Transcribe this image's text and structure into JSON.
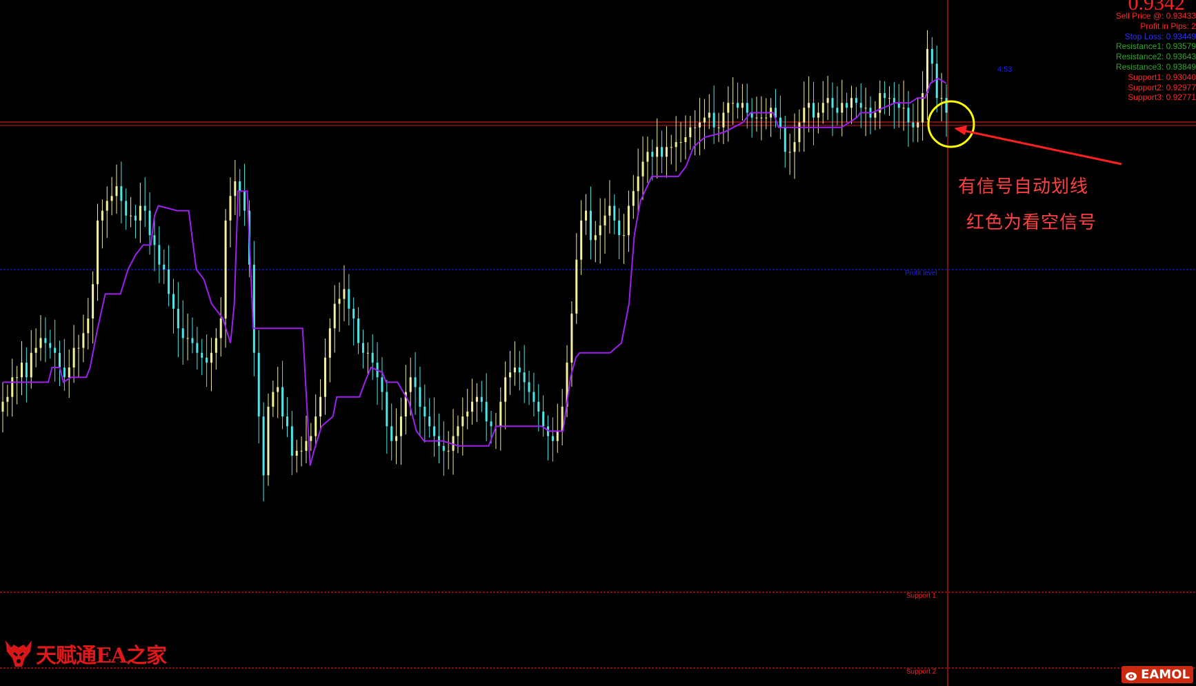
{
  "info_panel": {
    "current_price": "0.9342",
    "lines": [
      {
        "text": "Sell Price @: 0.93433",
        "color": "#ff2a2a"
      },
      {
        "text": "Profit in Pips: 2",
        "color": "#ff2a2a"
      },
      {
        "text": "Stop Loss: 0.93449",
        "color": "#3030ff"
      },
      {
        "text": "Resistance1: 0.93579",
        "color": "#2fa82f"
      },
      {
        "text": "Resistance2: 0.93643",
        "color": "#2fa82f"
      },
      {
        "text": "Resistance3: 0.93849",
        "color": "#2fa82f"
      },
      {
        "text": "Support1: 0.93040",
        "color": "#ff2a2a"
      },
      {
        "text": "Support2: 0.92977",
        "color": "#ff2a2a"
      },
      {
        "text": "Support3: 0.92771",
        "color": "#ff2a2a"
      }
    ]
  },
  "bar_timer": "4:53",
  "levels": {
    "profit_level": "Profit level",
    "support1": "Support 1",
    "support2": "Support 2"
  },
  "annotation": {
    "line1": "有信号自动划线",
    "line2": "红色为看空信号"
  },
  "watermark": {
    "brand": "天赋通EA之家",
    "site": "EAMOL"
  },
  "colors": {
    "background": "#000000",
    "bull_candle": "#f5f0a0",
    "bear_candle": "#4fe8e8",
    "signal_line": "#a020f0",
    "price_line": "#ff2020",
    "profit_level": "#2020ff",
    "support_level": "#ff2020",
    "highlight_circle": "#ffff00"
  },
  "chart_data": {
    "type": "candlestick",
    "title": "",
    "ylim": [
      0.925,
      0.939
    ],
    "grid": false,
    "horizontal_levels": [
      {
        "name": "Support 1",
        "value": 0.9304
      },
      {
        "name": "Support 2",
        "value": 0.92977
      }
    ],
    "closes": [
      0.9308,
      0.9309,
      0.9313,
      0.9313,
      0.9316,
      0.9313,
      0.9318,
      0.9319,
      0.9321,
      0.932,
      0.9319,
      0.9318,
      0.9315,
      0.9313,
      0.9315,
      0.9319,
      0.9319,
      0.9322,
      0.9325,
      0.9332,
      0.9345,
      0.9347,
      0.9349,
      0.935,
      0.9352,
      0.9349,
      0.9346,
      0.9346,
      0.9345,
      0.9348,
      0.9347,
      0.9342,
      0.934,
      0.9336,
      0.9335,
      0.933,
      0.9327,
      0.9323,
      0.9321,
      0.9321,
      0.932,
      0.9318,
      0.9317,
      0.9316,
      0.9318,
      0.9321,
      0.9325,
      0.9345,
      0.935,
      0.9353,
      0.9351,
      0.9347,
      0.9336,
      0.9318,
      0.9305,
      0.9293,
      0.9307,
      0.931,
      0.9311,
      0.9305,
      0.9303,
      0.9297,
      0.9298,
      0.9298,
      0.93,
      0.9301,
      0.9305,
      0.9309,
      0.9317,
      0.9323,
      0.9328,
      0.9329,
      0.9331,
      0.9327,
      0.9325,
      0.932,
      0.9318,
      0.9318,
      0.9316,
      0.9313,
      0.931,
      0.9303,
      0.93,
      0.9301,
      0.9305,
      0.931,
      0.9313,
      0.9311,
      0.9307,
      0.9305,
      0.9303,
      0.9301,
      0.9299,
      0.9298,
      0.9298,
      0.9301,
      0.9303,
      0.9305,
      0.9306,
      0.9308,
      0.9309,
      0.9308,
      0.9304,
      0.9303,
      0.9303,
      0.9308,
      0.9313,
      0.9314,
      0.9315,
      0.9314,
      0.9312,
      0.931,
      0.9308,
      0.9306,
      0.9303,
      0.9301,
      0.93,
      0.9302,
      0.9307,
      0.9316,
      0.9326,
      0.9337,
      0.9345,
      0.9347,
      0.9341,
      0.9342,
      0.9344,
      0.9346,
      0.9348,
      0.9345,
      0.9342,
      0.9342,
      0.9348,
      0.9351,
      0.9354,
      0.9357,
      0.9359,
      0.9358,
      0.936,
      0.9358,
      0.936,
      0.936,
      0.9361,
      0.9361,
      0.9362,
      0.9364,
      0.9364,
      0.9365,
      0.9366,
      0.9367,
      0.9364,
      0.9364,
      0.9367,
      0.9369,
      0.9369,
      0.9368,
      0.9369,
      0.9367,
      0.9366,
      0.9366,
      0.9366,
      0.9366,
      0.9368,
      0.9366,
      0.9364,
      0.9359,
      0.9359,
      0.9361,
      0.9365,
      0.9368,
      0.9369,
      0.9366,
      0.9367,
      0.9369,
      0.937,
      0.9368,
      0.9367,
      0.9369,
      0.9368,
      0.937,
      0.9369,
      0.9368,
      0.9368,
      0.9366,
      0.9367,
      0.9371,
      0.937,
      0.937,
      0.9369,
      0.9368,
      0.9368,
      0.9365,
      0.9364,
      0.9365,
      0.9371,
      0.938,
      0.9377,
      0.937,
      0.937,
      0.9367
    ],
    "signal_line": [
      [
        0,
        0.9312
      ],
      [
        60,
        0.9312
      ],
      [
        65,
        0.9315
      ],
      [
        75,
        0.9315
      ],
      [
        80,
        0.9312
      ],
      [
        90,
        0.9313
      ],
      [
        110,
        0.9313
      ],
      [
        115,
        0.9315
      ],
      [
        125,
        0.9323
      ],
      [
        135,
        0.933
      ],
      [
        155,
        0.933
      ],
      [
        165,
        0.9335
      ],
      [
        175,
        0.9338
      ],
      [
        185,
        0.934
      ],
      [
        195,
        0.934
      ],
      [
        200,
        0.9346
      ],
      [
        205,
        0.9348
      ],
      [
        230,
        0.9347
      ],
      [
        245,
        0.9347
      ],
      [
        255,
        0.9335
      ],
      [
        265,
        0.9333
      ],
      [
        275,
        0.9328
      ],
      [
        290,
        0.9325
      ],
      [
        300,
        0.932
      ],
      [
        305,
        0.9328
      ],
      [
        310,
        0.9351
      ],
      [
        322,
        0.9351
      ],
      [
        330,
        0.9323
      ],
      [
        395,
        0.9323
      ],
      [
        405,
        0.9295
      ],
      [
        410,
        0.9298
      ],
      [
        420,
        0.9303
      ],
      [
        435,
        0.9305
      ],
      [
        440,
        0.9309
      ],
      [
        470,
        0.9309
      ],
      [
        477,
        0.9312
      ],
      [
        485,
        0.9315
      ],
      [
        500,
        0.9314
      ],
      [
        505,
        0.9312
      ],
      [
        520,
        0.9312
      ],
      [
        535,
        0.9308
      ],
      [
        545,
        0.9302
      ],
      [
        555,
        0.93
      ],
      [
        565,
        0.93
      ],
      [
        580,
        0.93
      ],
      [
        600,
        0.9299
      ],
      [
        640,
        0.9299
      ],
      [
        650,
        0.9303
      ],
      [
        710,
        0.9303
      ],
      [
        720,
        0.9302
      ],
      [
        738,
        0.9302
      ],
      [
        748,
        0.9313
      ],
      [
        755,
        0.9317
      ],
      [
        760,
        0.9318
      ],
      [
        800,
        0.9318
      ],
      [
        815,
        0.932
      ],
      [
        825,
        0.9328
      ],
      [
        832,
        0.9342
      ],
      [
        840,
        0.9349
      ],
      [
        855,
        0.9354
      ],
      [
        890,
        0.9354
      ],
      [
        900,
        0.9356
      ],
      [
        910,
        0.936
      ],
      [
        925,
        0.9362
      ],
      [
        950,
        0.9363
      ],
      [
        975,
        0.9365
      ],
      [
        985,
        0.9367
      ],
      [
        1015,
        0.9367
      ],
      [
        1022,
        0.9364
      ],
      [
        1105,
        0.9364
      ],
      [
        1115,
        0.9365
      ],
      [
        1125,
        0.9366
      ],
      [
        1130,
        0.9367
      ],
      [
        1145,
        0.9367
      ],
      [
        1160,
        0.9368
      ],
      [
        1175,
        0.9369
      ],
      [
        1195,
        0.9369
      ],
      [
        1205,
        0.937
      ],
      [
        1215,
        0.937
      ],
      [
        1222,
        0.9373
      ],
      [
        1232,
        0.9374
      ],
      [
        1243,
        0.9373
      ]
    ]
  }
}
